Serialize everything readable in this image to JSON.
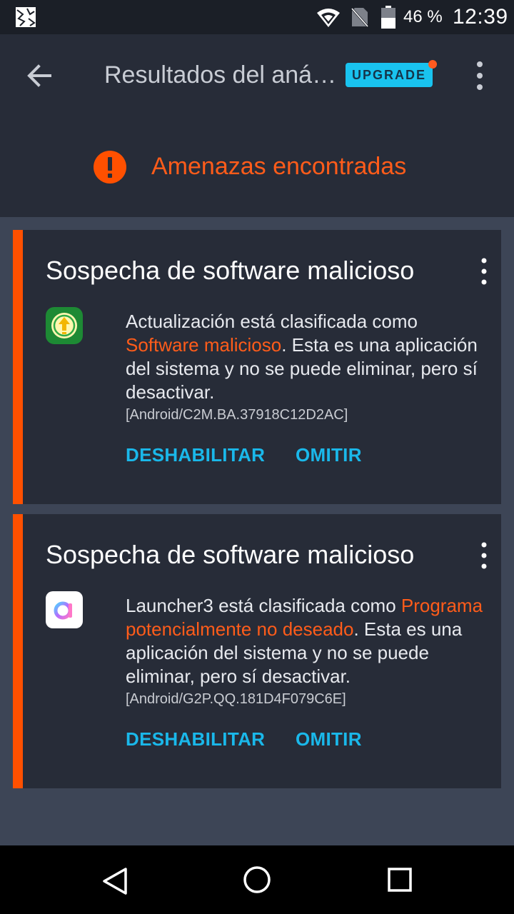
{
  "status_bar": {
    "battery_percent": "46 %",
    "time": "12:39"
  },
  "app_bar": {
    "title": "Resultados del aná…",
    "upgrade_label": "UPGRADE"
  },
  "summary": {
    "text": "Amenazas encontradas"
  },
  "cards": [
    {
      "heading": "Sospecha de software malicioso",
      "app_name_text": "Actualización está clasificada como ",
      "classification": "Software malicioso",
      "description_tail": ". Esta es una aplicación del sistema y no se puede eliminar, pero sí desactivar.",
      "detection_code": "[Android/C2M.BA.37918C12D2AC]",
      "disable_label": "DESHABILITAR",
      "skip_label": "OMITIR"
    },
    {
      "heading": "Sospecha de software malicioso",
      "app_name_text": "Launcher3 está clasificada como ",
      "classification": "Programa potencialmente no deseado",
      "description_tail": ". Esta es una aplicación del sistema y no se puede eliminar, pero sí desactivar.",
      "detection_code": "[Android/G2P.QQ.181D4F079C6E]",
      "disable_label": "DESHABILITAR",
      "skip_label": "OMITIR"
    }
  ],
  "icons": {
    "notification": "gallery-notification-icon",
    "wifi": "wifi-icon",
    "sim": "no-sim-icon",
    "battery": "battery-icon",
    "back": "arrow-back-icon",
    "more": "more-vert-icon",
    "threat": "alert-circle-icon",
    "card1_app": "system-update-app-icon",
    "card2_app": "launcher-app-icon",
    "nav_back": "nav-back-icon",
    "nav_home": "nav-home-icon",
    "nav_recents": "nav-recents-icon"
  },
  "colors": {
    "accent_orange": "#ff5c1a",
    "accent_cyan": "#1ab8ea",
    "card_background": "#272c38",
    "page_background": "#3d4556"
  }
}
